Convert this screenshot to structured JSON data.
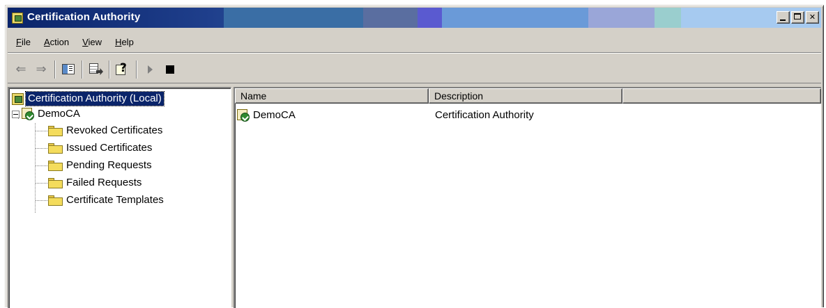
{
  "window": {
    "title": "Certification Authority",
    "icon": "certsrv-icon"
  },
  "menu": [
    {
      "label_prefix": "",
      "accel": "F",
      "label_rest": "ile"
    },
    {
      "label_prefix": "",
      "accel": "A",
      "label_rest": "ction"
    },
    {
      "label_prefix": "",
      "accel": "V",
      "label_rest": "iew"
    },
    {
      "label_prefix": "",
      "accel": "H",
      "label_rest": "elp"
    }
  ],
  "toolbar": {
    "buttons": [
      "back-arrow-icon",
      "forward-arrow-icon",
      "show-hide-tree-icon",
      "export-list-icon",
      "help-icon",
      "start-service-icon",
      "stop-service-icon"
    ]
  },
  "tree": {
    "root": "Certification Authority (Local)",
    "ca": "DemoCA",
    "folders": [
      "Revoked Certificates",
      "Issued Certificates",
      "Pending Requests",
      "Failed Requests",
      "Certificate Templates"
    ]
  },
  "list": {
    "columns": [
      "Name",
      "Description",
      ""
    ],
    "rows": [
      {
        "name": "DemoCA",
        "description": "Certification Authority"
      }
    ]
  },
  "colors": {
    "title_start": "#0a246a",
    "title_end": "#a6caf0",
    "selection": "#0a246a",
    "face": "#d4d0c8"
  }
}
